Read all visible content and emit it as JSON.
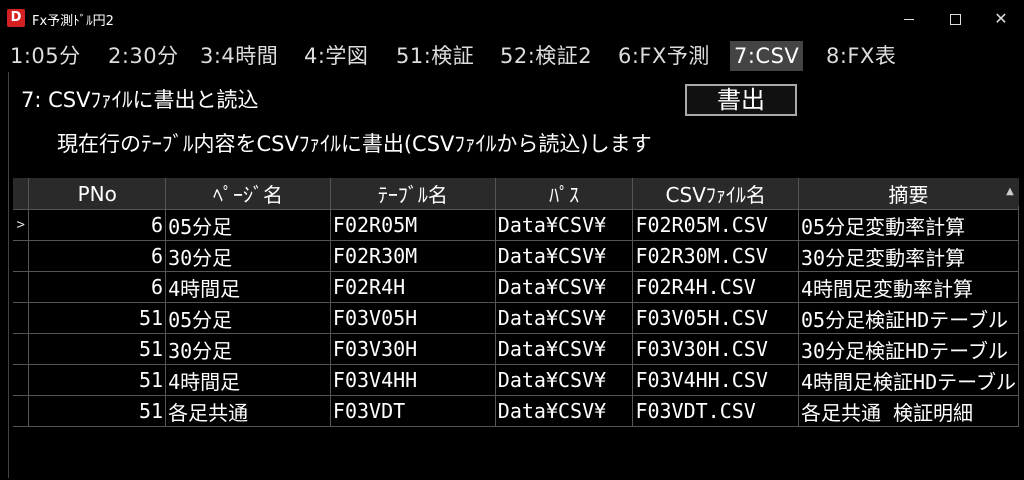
{
  "window": {
    "app_icon_letter": "D",
    "title": "Fx予測ﾄﾞﾙ円2"
  },
  "tabs": [
    {
      "label": "1:05分"
    },
    {
      "label": "2:30分"
    },
    {
      "label": "3:4時間"
    },
    {
      "label": "4:学図"
    },
    {
      "label": "51:検証"
    },
    {
      "label": "52:検証2"
    },
    {
      "label": "6:FX予測"
    },
    {
      "label": "7:CSV"
    },
    {
      "label": "8:FX表"
    }
  ],
  "active_tab": 7,
  "panel": {
    "heading": "7: CSVﾌｧｲﾙに書出と読込",
    "export_button": "書出",
    "description": "現在行のﾃｰﾌﾞﾙ内容をCSVﾌｧｲﾙに書出(CSVﾌｧｲﾙから読込)します"
  },
  "grid": {
    "headers": [
      "PNo",
      "ﾍﾟｰｼﾞ名",
      "ﾃｰﾌﾞﾙ名",
      "ﾊﾟｽ",
      "CSVﾌｧｲﾙ名",
      "摘要"
    ],
    "current_row_marker": ">",
    "rows": [
      [
        "6",
        "05分足",
        "F02R05M",
        "Data¥CSV¥",
        "F02R05M.CSV",
        "05分足変動率計算"
      ],
      [
        "6",
        "30分足",
        "F02R30M",
        "Data¥CSV¥",
        "F02R30M.CSV",
        "30分足変動率計算"
      ],
      [
        "6",
        "4時間足",
        "F02R4H",
        "Data¥CSV¥",
        "F02R4H.CSV",
        "4時間足変動率計算"
      ],
      [
        "51",
        "05分足",
        "F03V05H",
        "Data¥CSV¥",
        "F03V05H.CSV",
        "05分足検証HDテーブル"
      ],
      [
        "51",
        "30分足",
        "F03V30H",
        "Data¥CSV¥",
        "F03V30H.CSV",
        "30分足検証HDテーブル"
      ],
      [
        "51",
        "4時間足",
        "F03V4HH",
        "Data¥CSV¥",
        "F03V4HH.CSV",
        "4時間足検証HDテーブル"
      ],
      [
        "51",
        "各足共通",
        "F03VDT",
        "Data¥CSV¥",
        "F03VDT.CSV",
        "各足共通 検証明細"
      ]
    ]
  }
}
